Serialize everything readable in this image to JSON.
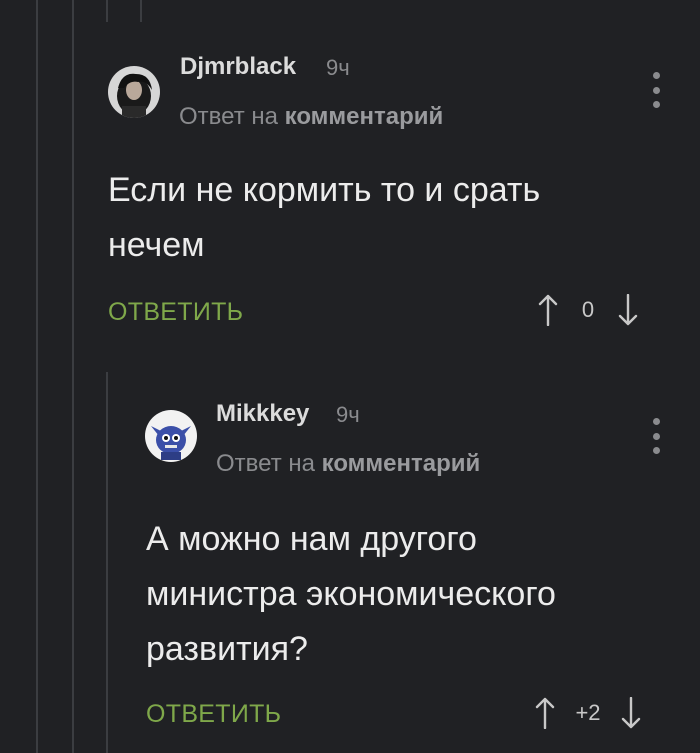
{
  "comments": [
    {
      "username": "Djmrblack",
      "time": "9ч",
      "reply_prefix": "Ответ на",
      "reply_link": "комментарий",
      "text_lines": [
        "Если не кормить то и срать",
        "нечем"
      ],
      "reply_label": "ОТВЕТИТЬ",
      "score": "0"
    },
    {
      "username": "Mikkkey",
      "time": "9ч",
      "reply_prefix": "Ответ на",
      "reply_link": "комментарий",
      "text_lines": [
        "А можно нам другого",
        "министра экономического",
        "развития?"
      ],
      "reply_label": "ОТВЕТИТЬ",
      "score": "+2"
    }
  ],
  "colors": {
    "background": "#202124",
    "thread_line": "#3b3d41",
    "reply_green": "#7fa84a",
    "muted": "#8a8b8e"
  },
  "icons": {
    "upvote": "arrow-up-icon",
    "downvote": "arrow-down-icon",
    "menu": "more-vertical-icon"
  }
}
